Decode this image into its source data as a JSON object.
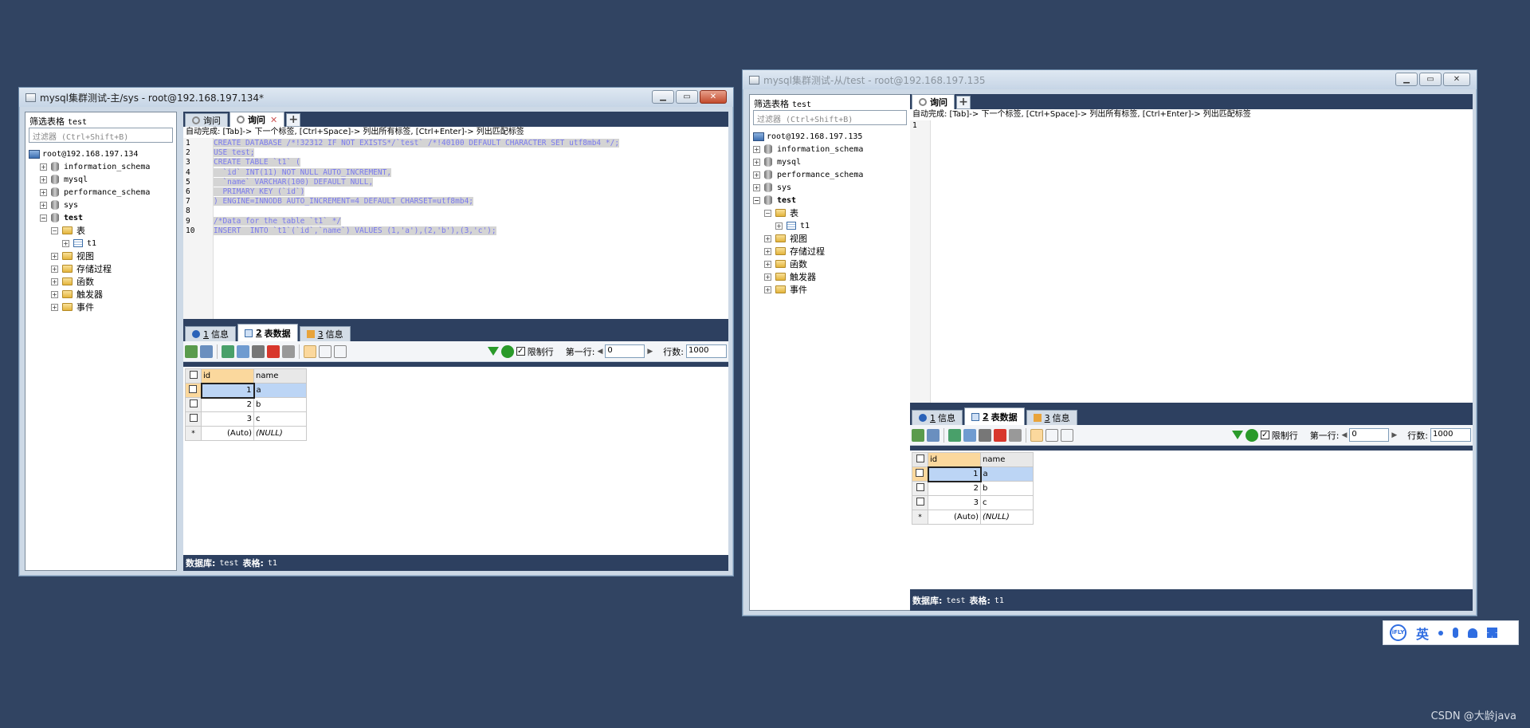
{
  "left_window": {
    "title": "mysql集群测试-主/sys - root@192.168.197.134*",
    "window_buttons": {
      "minimize": "▁",
      "maximize": "▭",
      "close": "✕"
    },
    "sidebar": {
      "filter_label": "筛选表格",
      "filter_value": "test",
      "filter_placeholder": "过滤器 (Ctrl+Shift+B)",
      "tree": {
        "server": "root@192.168.197.134",
        "databases": [
          "information_schema",
          "mysql",
          "performance_schema",
          "sys"
        ],
        "selected_db": "test",
        "tables_folder": "表",
        "table": "t1",
        "folders": [
          "视图",
          "存储过程",
          "函数",
          "触发器",
          "事件"
        ]
      }
    },
    "tabs": [
      {
        "label": "询问",
        "active": false
      },
      {
        "label": "询问",
        "active": true,
        "close": "✕"
      }
    ],
    "add_tab": "+",
    "autocomplete_hint": "自动完成: [Tab]-> 下一个标签, [Ctrl+Space]-> 列出所有标签, [Ctrl+Enter]-> 列出匹配标签",
    "line_numbers": [
      "1",
      "2",
      "3",
      "4",
      "5",
      "6",
      "7",
      "8",
      "9",
      "10"
    ],
    "code_lines": [
      "CREATE DATABASE /*!32312 IF NOT EXISTS*/`test` /*!40100 DEFAULT CHARACTER SET utf8mb4 */;",
      "USE test;",
      "CREATE TABLE `t1` (",
      "  `id` INT(11) NOT NULL AUTO_INCREMENT,",
      "  `name` VARCHAR(100) DEFAULT NULL,",
      "  PRIMARY KEY (`id`)",
      ") ENGINE=INNODB AUTO_INCREMENT=4 DEFAULT CHARSET=utf8mb4;",
      "",
      "/*Data for the table `t1` */",
      "INSERT  INTO `t1`(`id`,`name`) VALUES (1,'a'),(2,'b'),(3,'c');"
    ],
    "result_tabs": [
      {
        "num": "1",
        "label": "信息"
      },
      {
        "num": "2",
        "label": "表数据"
      },
      {
        "num": "3",
        "label": "信息"
      }
    ],
    "toolbar": {
      "limit_checkbox": "✓",
      "limit_label": "限制行",
      "first_row_label": "第一行:",
      "first_row_value": "0",
      "rows_label": "行数:",
      "rows_value": "1000"
    },
    "grid": {
      "columns": [
        "id",
        "name"
      ],
      "rows": [
        [
          "1",
          "a"
        ],
        [
          "2",
          "b"
        ],
        [
          "3",
          "c"
        ]
      ],
      "new_row": [
        "(Auto)",
        "(NULL)"
      ],
      "new_row_marker": "*"
    },
    "status": {
      "db_label": "数据库:",
      "db_value": "test",
      "table_label": "表格:",
      "table_value": "t1"
    }
  },
  "right_window": {
    "title": "mysql集群测试-从/test - root@192.168.197.135",
    "window_buttons": {
      "minimize": "▁",
      "maximize": "▭",
      "close": "✕"
    },
    "sidebar": {
      "filter_label": "筛选表格",
      "filter_value": "test",
      "filter_placeholder": "过滤器 (Ctrl+Shift+B)",
      "tree": {
        "server": "root@192.168.197.135",
        "databases": [
          "information_schema",
          "mysql",
          "performance_schema",
          "sys"
        ],
        "selected_db": "test",
        "tables_folder": "表",
        "table": "t1",
        "folders": [
          "视图",
          "存储过程",
          "函数",
          "触发器",
          "事件"
        ]
      }
    },
    "tabs": [
      {
        "label": "询问",
        "active": true
      }
    ],
    "add_tab": "+",
    "autocomplete_hint": "自动完成: [Tab]-> 下一个标签, [Ctrl+Space]-> 列出所有标签, [Ctrl+Enter]-> 列出匹配标签",
    "line_numbers": [
      "1"
    ],
    "result_tabs": [
      {
        "num": "1",
        "label": "信息"
      },
      {
        "num": "2",
        "label": "表数据"
      },
      {
        "num": "3",
        "label": "信息"
      }
    ],
    "toolbar": {
      "limit_checkbox": "✓",
      "limit_label": "限制行",
      "first_row_label": "第一行:",
      "first_row_value": "0",
      "rows_label": "行数:",
      "rows_value": "1000"
    },
    "grid": {
      "columns": [
        "id",
        "name"
      ],
      "rows": [
        [
          "1",
          "a"
        ],
        [
          "2",
          "b"
        ],
        [
          "3",
          "c"
        ]
      ],
      "new_row": [
        "(Auto)",
        "(NULL)"
      ],
      "new_row_marker": "*"
    },
    "status": {
      "db_label": "数据库:",
      "db_value": "test",
      "table_label": "表格:",
      "table_value": "t1"
    }
  },
  "ime_bar": {
    "logo": "iFLY",
    "lang": "英"
  },
  "watermark": "CSDN @大龄java"
}
